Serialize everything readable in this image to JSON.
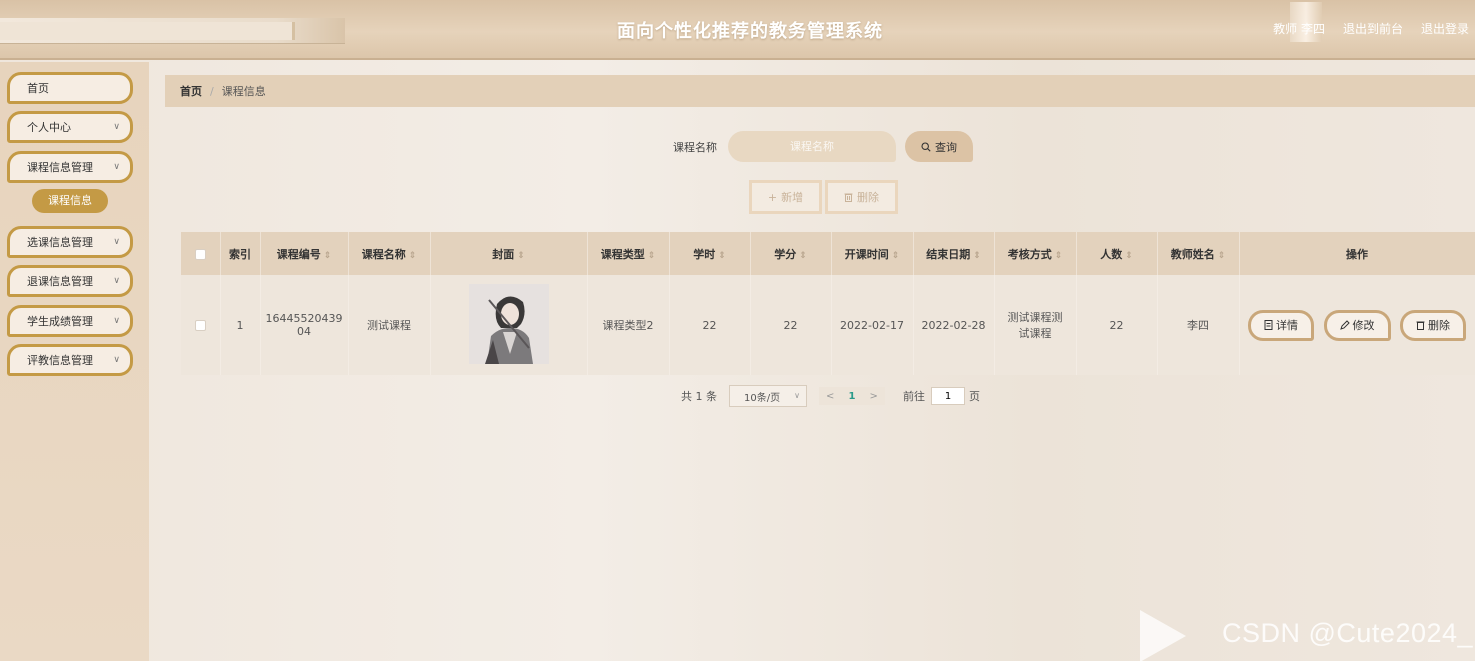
{
  "header": {
    "title": "面向个性化推荐的教务管理系统",
    "user": "教师 李四",
    "back_to_front": "退出到前台",
    "logout": "退出登录"
  },
  "sidebar": {
    "items": [
      {
        "label": "首页",
        "has_chevron": false
      },
      {
        "label": "个人中心",
        "has_chevron": true
      },
      {
        "label": "课程信息管理",
        "has_chevron": true
      },
      {
        "label": "选课信息管理",
        "has_chevron": true
      },
      {
        "label": "退课信息管理",
        "has_chevron": true
      },
      {
        "label": "学生成绩管理",
        "has_chevron": true
      },
      {
        "label": "评教信息管理",
        "has_chevron": true
      }
    ],
    "active_sub": "课程信息",
    "chevron": "∨"
  },
  "breadcrumb": {
    "home": "首页",
    "sep": "/",
    "current": "课程信息"
  },
  "search": {
    "label": "课程名称",
    "placeholder": "课程名称",
    "button": "查询"
  },
  "actions": {
    "add": "新增",
    "delete": "删除"
  },
  "table": {
    "headers": [
      "索引",
      "课程编号",
      "课程名称",
      "封面",
      "课程类型",
      "学时",
      "学分",
      "开课时间",
      "结束日期",
      "考核方式",
      "人数",
      "教师姓名",
      "操作"
    ],
    "rows": [
      {
        "index": "1",
        "course_no_line1": "16445520439",
        "course_no_line2": "04",
        "course_name": "测试课程",
        "course_type": "课程类型2",
        "hours": "22",
        "credits": "22",
        "start_date": "2022-02-17",
        "end_date": "2022-02-28",
        "exam_line1": "测试课程测",
        "exam_line2": "试课程",
        "count": "22",
        "teacher": "李四",
        "ops": {
          "detail": "详情",
          "edit": "修改",
          "delete": "删除"
        }
      }
    ]
  },
  "pagination": {
    "total": "共 1 条",
    "page_size": "10条/页",
    "current_page": "1",
    "goto_label": "前往",
    "goto_value": "1",
    "page_suffix": "页"
  },
  "watermark": "CSDN @Cute2024_"
}
